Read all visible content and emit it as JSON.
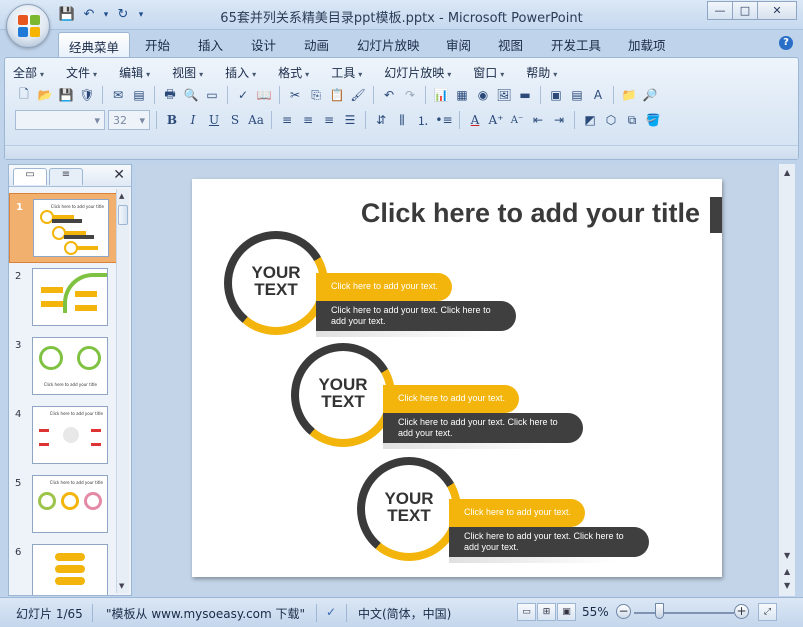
{
  "window": {
    "title": "65套并列关系精美目录ppt模板.pptx - Microsoft PowerPoint",
    "minimize": "—",
    "maximize": "□",
    "close": "✕"
  },
  "qat": {
    "save": "💾",
    "undo": "↶",
    "undo_dd": "▾",
    "redo": "↻",
    "customize": "▾"
  },
  "tabs": [
    {
      "label": "经典菜单",
      "active": true
    },
    {
      "label": "开始"
    },
    {
      "label": "插入"
    },
    {
      "label": "设计"
    },
    {
      "label": "动画"
    },
    {
      "label": "幻灯片放映"
    },
    {
      "label": "审阅"
    },
    {
      "label": "视图"
    },
    {
      "label": "开发工具"
    },
    {
      "label": "加载项"
    }
  ],
  "help": "?",
  "menu": [
    "全部",
    "文件",
    "编辑",
    "视图",
    "插入",
    "格式",
    "工具",
    "幻灯片放映",
    "窗口",
    "帮助"
  ],
  "menu_dd": "▾",
  "toolbar": {
    "font_name": "",
    "font_size": "32",
    "combo_arrow": "▾"
  },
  "pane": {
    "tab1": "▭",
    "tab2": "≡",
    "close": "✕"
  },
  "thumbs": [
    {
      "num": "1",
      "title": "Click here to add your title",
      "selected": true
    },
    {
      "num": "2",
      "title": ""
    },
    {
      "num": "3",
      "title": "Click here to add your title"
    },
    {
      "num": "4",
      "title": "Click here to add your title"
    },
    {
      "num": "5",
      "title": "Click here to add your title"
    },
    {
      "num": "6",
      "title": ""
    }
  ],
  "slide": {
    "title": "Click here to add your title",
    "groups": [
      {
        "circle_line1": "YOUR",
        "circle_line2": "TEXT",
        "yellow": "Click here to add your text.",
        "dark": "Click here to add your text. Click here to add your text."
      },
      {
        "circle_line1": "YOUR",
        "circle_line2": "TEXT",
        "yellow": "Click here to add your text.",
        "dark": "Click here to add your text. Click here to add your text."
      },
      {
        "circle_line1": "YOUR",
        "circle_line2": "TEXT",
        "yellow": "Click here to add your text.",
        "dark": "Click here to add your text. Click here to add your text."
      }
    ]
  },
  "status": {
    "slide_pos": "幻灯片 1/65",
    "template": "\"模板从 www.mysoeasy.com 下载\"",
    "language": "中文(简体，中国)",
    "zoom": "55%",
    "zoom_out": "−",
    "zoom_in": "+"
  },
  "colors": {
    "accent_yellow": "#f3b50b",
    "dark_gray": "#3a3a3a",
    "ribbon_blue": "#bfd3ea"
  }
}
